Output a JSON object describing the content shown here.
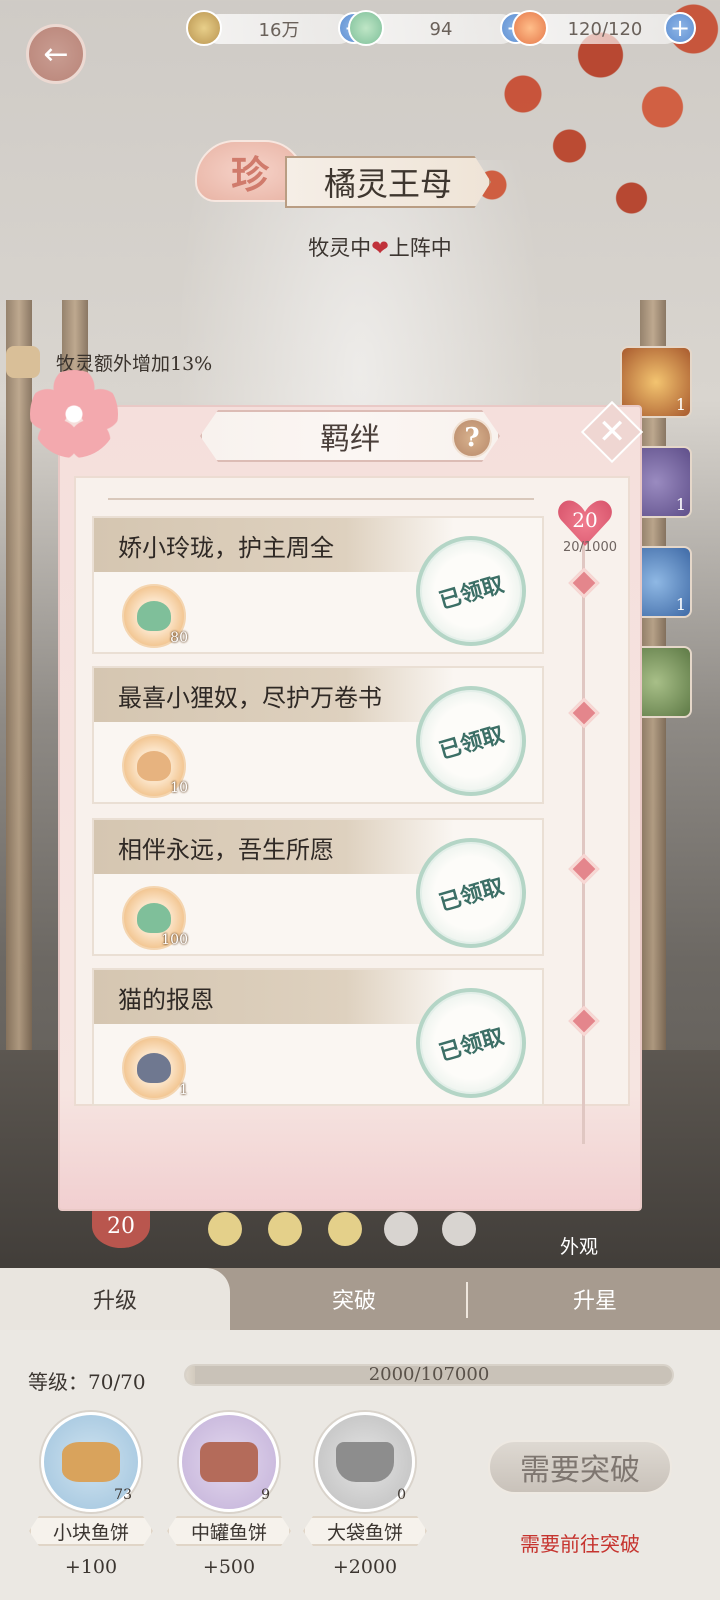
{
  "resources": {
    "coins": "16万",
    "jade": "94",
    "stamina": "120/120"
  },
  "spirit": {
    "rank": "珍",
    "name": "橘灵王母",
    "status_left": "牧灵中",
    "status_right": "上阵中",
    "bonus": "牧灵额外增加13%"
  },
  "side_spirits": [
    {
      "count": "1"
    },
    {
      "count": "1"
    },
    {
      "count": "1"
    },
    {
      "count": ""
    }
  ],
  "modal": {
    "title": "羁绊",
    "help": "?",
    "heart_level": "20",
    "heart_progress": "20/1000",
    "bonds": [
      {
        "title": "娇小玲珑，护主周全",
        "reward_qty": "80",
        "status": "已领取"
      },
      {
        "title": "最喜小狸奴，尽护万卷书",
        "reward_qty": "10",
        "status": "已领取"
      },
      {
        "title": "相伴永远，吾生所愿",
        "reward_qty": "100",
        "status": "已领取"
      },
      {
        "title": "猫的报恩",
        "reward_qty": "1",
        "status": "已领取"
      }
    ]
  },
  "below_modal": {
    "level_badge": "20",
    "appearance": "外观"
  },
  "tabs": [
    {
      "label": "升级",
      "active": true
    },
    {
      "label": "突破",
      "active": false
    },
    {
      "label": "升星",
      "active": false
    }
  ],
  "upgrade": {
    "level_label": "等级：70/70",
    "xp_text": "2000/107000",
    "xp_fraction": 0.0187,
    "feeds": [
      {
        "name": "小块鱼饼",
        "count": "73",
        "gain": "+100"
      },
      {
        "name": "中罐鱼饼",
        "count": "9",
        "gain": "+500"
      },
      {
        "name": "大袋鱼饼",
        "count": "0",
        "gain": "+2000"
      }
    ],
    "break_button": "需要突破",
    "break_hint": "需要前往突破"
  },
  "colors": {
    "accent_red": "#c6342f",
    "claimed_green": "#3c6f66",
    "plus_blue": "#5e8fd2"
  }
}
